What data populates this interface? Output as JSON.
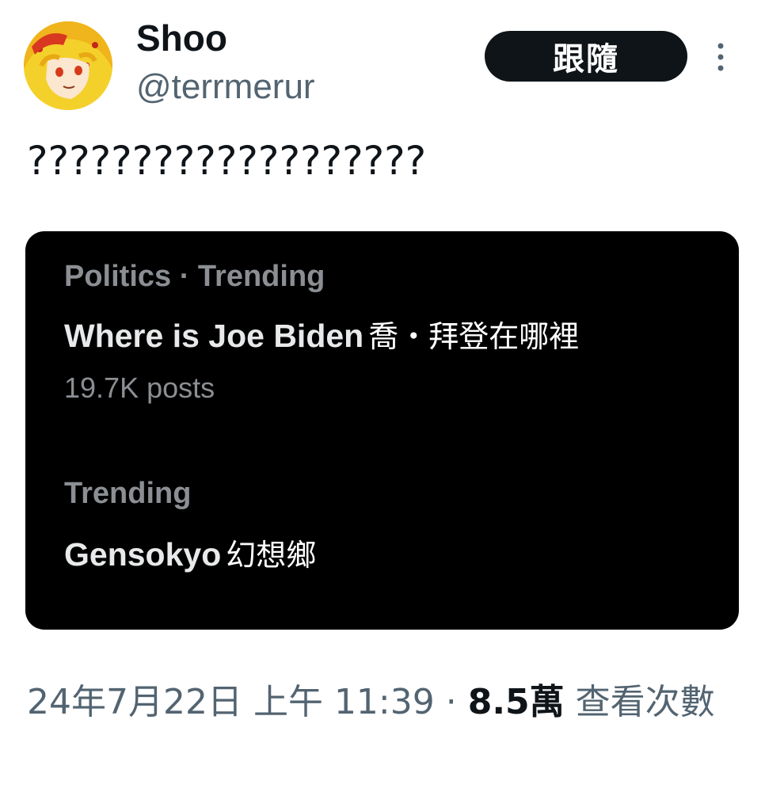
{
  "author": {
    "display_name": "Shoo",
    "handle": "@terrmerur",
    "avatar": "anime-character-avatar"
  },
  "follow_button": {
    "label": "跟隨"
  },
  "more_menu": {
    "icon": "more-vertical-icon"
  },
  "tweet": {
    "text": "???????????????????"
  },
  "media": {
    "trends": [
      {
        "category": "Politics · Trending",
        "title": "Where is Joe Biden",
        "title_translation": "喬・拜登在哪裡",
        "posts": "19.7K posts"
      },
      {
        "category": "Trending",
        "title": "Gensokyo",
        "title_translation": "幻想鄉"
      }
    ]
  },
  "meta": {
    "timestamp": "24年7月22日 上午 11:39",
    "separator": " · ",
    "views_count": "8.5萬",
    "views_label": " 查看次數"
  },
  "colors": {
    "text_primary": "#0f1419",
    "text_secondary": "#536471",
    "card_background": "#000000",
    "button_background": "#0f1419"
  }
}
